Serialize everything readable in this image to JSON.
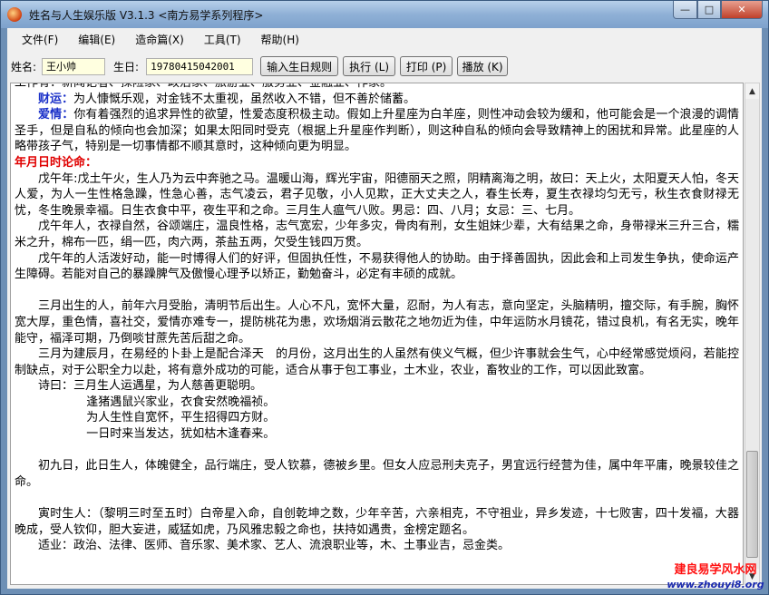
{
  "window": {
    "title": "姓名与人生娱乐版 V3.1.3   <南方易学系列程序>"
  },
  "menu": [
    "文件(F)",
    "编辑(E)",
    "造命篇(X)",
    "工具(T)",
    "帮助(H)"
  ],
  "toolbar": {
    "name_label": "姓名:",
    "name_value": "王小帅",
    "birth_label": "生日:",
    "birth_value": "19780415042001",
    "rule_button": "输入生日规则",
    "run_button": "执行 (L)",
    "print_button": "打印 (P)",
    "play_button": "播放 (K)"
  },
  "content": {
    "line_occupation": "工作有：新闻记者、探险家、政治家、旅游业、服务业、金融业、作家。",
    "wealth_label": "财运：",
    "wealth_text": "为人慷慨乐观，对金钱不太重视，虽然收入不错，但不善於储蓄。",
    "love_label": "爱情：",
    "love_text": "你有着强烈的追求异性的欲望，性爱态度积极主动。假如上升星座为白羊座，则性冲动会较为缓和，他可能会是一个浪漫的调情圣手，但是自私的倾向也会加深；如果太阳同时受克（根据上升星座作判断），则这种自私的倾向会导致精神上的困扰和异常。此星座的人略带孩子气，特别是一切事情都不顺其意时，这种倾向更为明显。",
    "heading": "年月日时论命：",
    "p1": "戊午年:戊土午火，生人乃为云中奔驰之马。温暖山海，辉光宇宙，阳德丽天之照，阴精离海之明，故曰：天上火，太阳夏天人怕，冬天人爱，为人一生性格急躁，性急心善，志气凌云，君子见敬，小人见欺，正大丈夫之人，春生长寿，夏生衣禄均匀无亏，秋生衣食财禄无忧，冬生晚景幸福。日生衣食中平，夜生平和之命。三月生人瘟气八败。男忌：四、八月；女忌：三、七月。",
    "p2": "戊午年人，衣禄自然，谷颂端庄，温良性格，志气宽宏，少年多灾，骨肉有刑，女生姐妹少辈，大有结果之命，身带禄米三升三合，糯米之升，棉布一匹，绢一匹，肉六两，茶盐五两，欠受生钱四万贯。",
    "p3": "戊午年的人活泼好动，能一时博得人们的好评，但固执任性，不易获得他人的协助。由于择善固执，因此会和上司发生争执，使命运产生障碍。若能对自己的暴躁脾气及傲慢心理予以矫正，勤勉奋斗，必定有丰硕的成就。",
    "p4": "三月出生的人，前年六月受胎，清明节后出生。人心不凡，宽怀大量，忍耐，为人有志，意向坚定，头脑精明，擅交际，有手腕，胸怀宽大厚，重色情，喜社交，爱情亦难专一，提防桃花为患，欢场烟消云散花之地勿近为佳，中年运防水月镜花，错过良机，有名无实，晚年能守，福泽可期，乃倒啖甘蔗先苦后甜之命。",
    "p5": "三月为建辰月，在易经的卜卦上是配合泽天　的月份，这月出生的人虽然有侠义气概，但少许事就会生气，心中经常感觉烦闷，若能控制缺点，对于公职全力以赴，将有意外成功的可能，适合从事于包工事业，土木业，农业，畜牧业的工作，可以因此致富。",
    "poem_lines": [
      "诗曰：三月生人运遇星，为人慈善更聪明。",
      "逢猪遇鼠兴家业，衣食安然晚福祯。",
      "为人生性自宽怀，平生招得四方财。",
      "一日时来当发达，犹如枯木逢春来。"
    ],
    "p6": "初九日，此日生人，体魄健全，品行端庄，受人钦慕，德被乡里。但女人应忌刑夫克子，男宜远行经营为佳，属中年平庸，晚景较佳之命。",
    "p7": "寅时生人：（黎明三时至五时）白帝星入命，自创乾坤之数，少年辛苦，六亲相克，不守祖业，异乡发迹，十七败害，四十发福，大器晚成，受人钦仰，胆大妄进，威猛如虎，乃风雅忠毅之命也，扶持如遇贵，金榜定题名。",
    "p8": "适业：政治、法律、医师、音乐家、美术家、艺人、流浪职业等，木、土事业吉，忌金类。"
  },
  "watermark": {
    "line1": "建良易学风水网",
    "line2": "www.zhouyi8.org"
  },
  "icons": {
    "titlebar": "app-icon",
    "minimize": "minimize-icon",
    "maximize": "maximize-icon",
    "close": "close-icon"
  }
}
